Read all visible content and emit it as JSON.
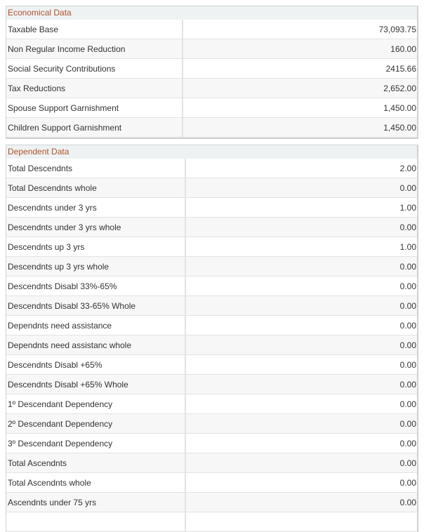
{
  "economical": {
    "title": "Economical Data",
    "rows": [
      {
        "label": "Taxable Base",
        "value": "73,093.75"
      },
      {
        "label": "Non Regular Income Reduction",
        "value": "160.00"
      },
      {
        "label": "Social Security Contributions",
        "value": "2415.66"
      },
      {
        "label": "Tax Reductions",
        "value": "2,652.00"
      },
      {
        "label": "Spouse Support Garnishment",
        "value": "1,450.00"
      },
      {
        "label": "Children Support Garnishment",
        "value": "1,450.00"
      }
    ]
  },
  "dependent": {
    "title": "Dependent Data",
    "rows": [
      {
        "label": "Total Descendnts",
        "value": "2.00"
      },
      {
        "label": "Total Descendnts whole",
        "value": "0.00"
      },
      {
        "label": "Descendnts under 3 yrs",
        "value": "1.00"
      },
      {
        "label": "Descendnts under 3 yrs whole",
        "value": "0.00"
      },
      {
        "label": "Descendnts up 3 yrs",
        "value": "1.00"
      },
      {
        "label": "Descendnts up 3 yrs whole",
        "value": "0.00"
      },
      {
        "label": "Descendnts Disabl 33%-65%",
        "value": "0.00"
      },
      {
        "label": "Descendnts Disabl 33-65% Whole",
        "value": "0.00"
      },
      {
        "label": "Dependnts need assistance",
        "value": "0.00"
      },
      {
        "label": "Dependnts need assistanc whole",
        "value": "0.00"
      },
      {
        "label": "Descendnts Disabl +65%",
        "value": "0.00"
      },
      {
        "label": "Descendnts Disabl +65% Whole",
        "value": "0.00"
      },
      {
        "label": "1º Descendant Dependency",
        "value": "0.00"
      },
      {
        "label": "2º Descendant Dependency",
        "value": "0.00"
      },
      {
        "label": "3º Descendant Dependency",
        "value": "0.00"
      },
      {
        "label": "Total Ascendnts",
        "value": "0.00"
      },
      {
        "label": "Total Ascendnts whole",
        "value": "0.00"
      },
      {
        "label": "Ascendnts under 75 yrs",
        "value": "0.00"
      },
      {
        "label": "",
        "value": ""
      }
    ]
  }
}
